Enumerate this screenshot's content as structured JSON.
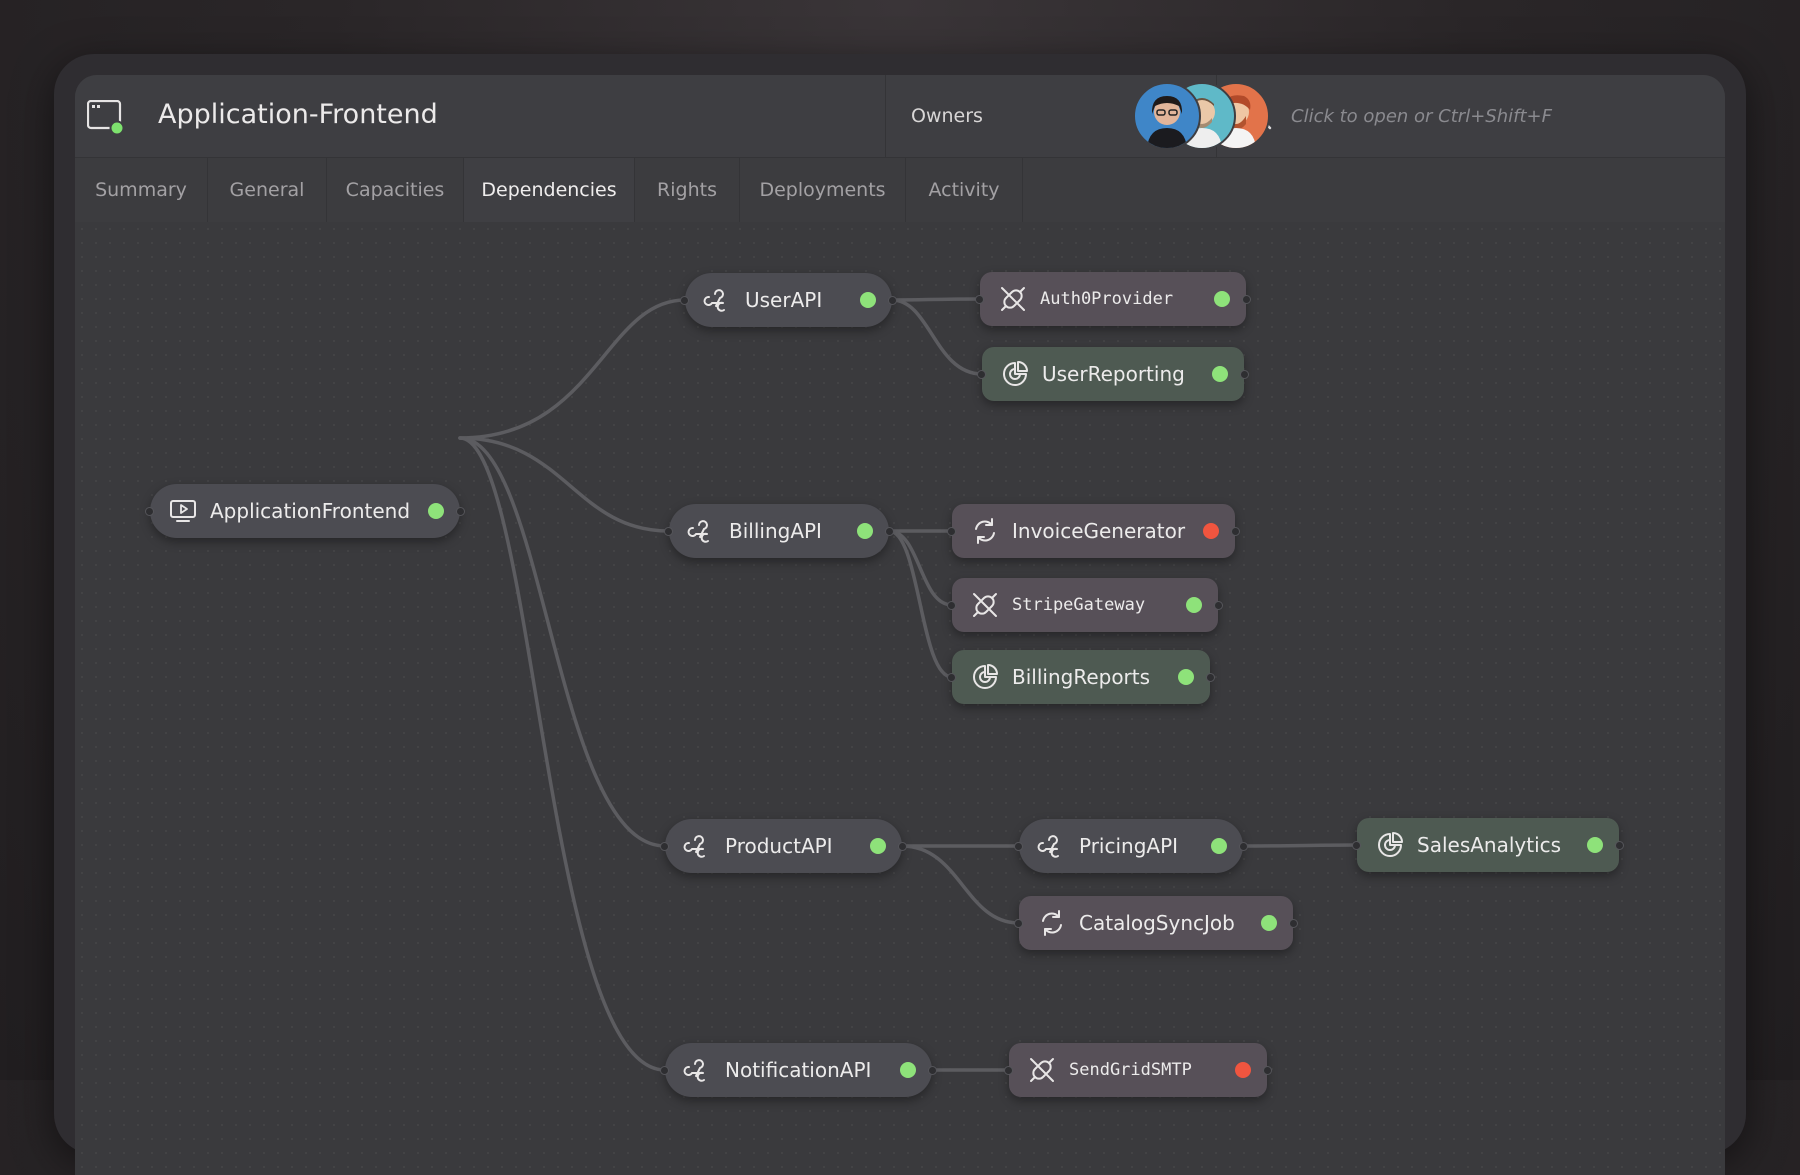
{
  "header": {
    "app_title": "Application-Frontend",
    "owners_label": "Owners",
    "search_placeholder": "Click to open or Ctrl+Shift+F"
  },
  "tabs": [
    {
      "label": "Summary"
    },
    {
      "label": "General"
    },
    {
      "label": "Capacities"
    },
    {
      "label": "Dependencies",
      "active": true
    },
    {
      "label": "Rights"
    },
    {
      "label": "Deployments"
    },
    {
      "label": "Activity"
    }
  ],
  "colors": {
    "status_ok": "#8ee27a",
    "status_error": "#f0553f"
  },
  "nodes": {
    "application_frontend": {
      "label": "ApplicationFrontend",
      "icon": "monitor-play-icon",
      "status": "ok"
    },
    "user_api": {
      "label": "UserAPI",
      "icon": "webhook-icon",
      "status": "ok"
    },
    "auth0_provider": {
      "label": "Auth0Provider",
      "icon": "unplug-icon",
      "status": "ok"
    },
    "user_reporting": {
      "label": "UserReporting",
      "icon": "analytics-icon",
      "status": "ok"
    },
    "billing_api": {
      "label": "BillingAPI",
      "icon": "webhook-icon",
      "status": "ok"
    },
    "invoice_generator": {
      "label": "InvoiceGenerator",
      "icon": "refresh-icon",
      "status": "error"
    },
    "stripe_gateway": {
      "label": "StripeGateway",
      "icon": "unplug-icon",
      "status": "ok"
    },
    "billing_reports": {
      "label": "BillingReports",
      "icon": "analytics-icon",
      "status": "ok"
    },
    "product_api": {
      "label": "ProductAPI",
      "icon": "webhook-icon",
      "status": "ok"
    },
    "pricing_api": {
      "label": "PricingAPI",
      "icon": "webhook-icon",
      "status": "ok"
    },
    "sales_analytics": {
      "label": "SalesAnalytics",
      "icon": "analytics-icon",
      "status": "ok"
    },
    "catalog_sync_job": {
      "label": "CatalogSyncJob",
      "icon": "refresh-icon",
      "status": "ok"
    },
    "notification_api": {
      "label": "NotificationAPI",
      "icon": "webhook-icon",
      "status": "ok"
    },
    "sendgrid_smtp": {
      "label": "SendGridSMTP",
      "icon": "unplug-icon",
      "status": "error"
    }
  }
}
